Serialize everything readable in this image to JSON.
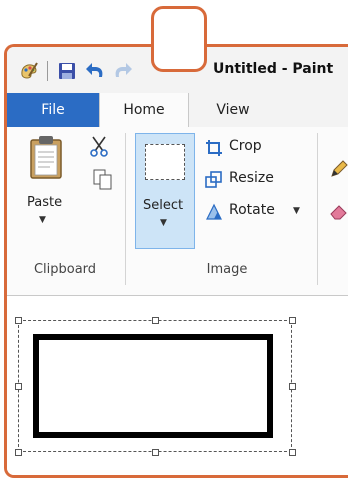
{
  "window": {
    "title": "Untitled - Paint"
  },
  "tabs": [
    {
      "label": "File"
    },
    {
      "label": "Home"
    },
    {
      "label": "View"
    }
  ],
  "clipboard": {
    "paste_label": "Paste",
    "group_label": "Clipboard"
  },
  "image": {
    "select_label": "Select",
    "crop_label": "Crop",
    "resize_label": "Resize",
    "rotate_label": "Rotate",
    "group_label": "Image"
  },
  "colors": {
    "accent": "#d86a3a",
    "file_tab": "#2b6cc4",
    "select_bg": "#cde4f7"
  }
}
